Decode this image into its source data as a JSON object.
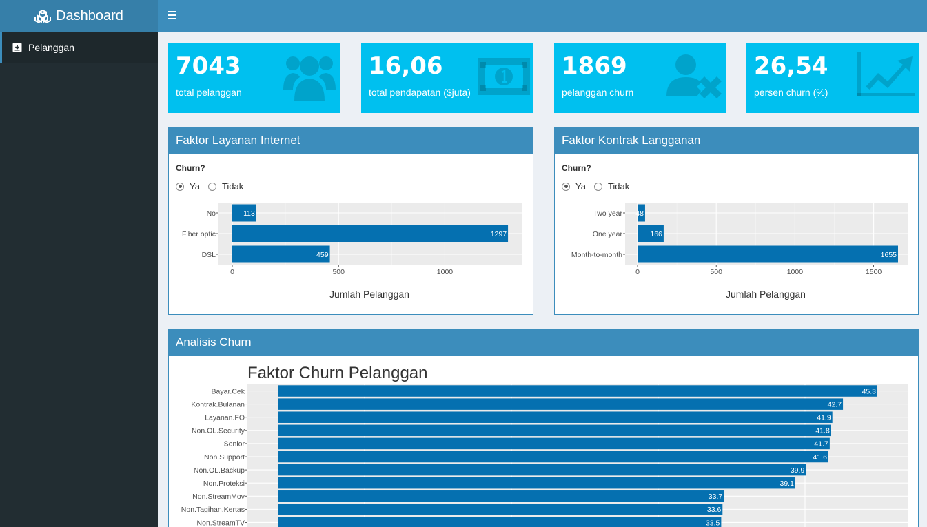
{
  "brand": {
    "title": "Dashboard"
  },
  "sidebar": {
    "items": [
      {
        "label": "Pelanggan"
      }
    ]
  },
  "value_boxes": [
    {
      "value": "7043",
      "label": "total pelanggan",
      "icon": "users-icon"
    },
    {
      "value": "16,06",
      "label": "total pendapatan ($juta)",
      "icon": "money-icon"
    },
    {
      "value": "1869",
      "label": "pelanggan churn",
      "icon": "user-times-icon"
    },
    {
      "value": "26,54",
      "label": "persen churn (%)",
      "icon": "line-chart-icon"
    }
  ],
  "colors": {
    "accent": "#3c8dbc",
    "value_box": "#00c0ef",
    "bar": "#0570b0",
    "sidebar": "#222d32"
  },
  "internet_box": {
    "title": "Faktor Layanan Internet",
    "radio_label": "Churn?",
    "options": [
      "Ya",
      "Tidak"
    ],
    "selected": "Ya"
  },
  "contract_box": {
    "title": "Faktor Kontrak Langganan",
    "radio_label": "Churn?",
    "options": [
      "Ya",
      "Tidak"
    ],
    "selected": "Ya"
  },
  "analysis_box": {
    "title": "Analisis Churn"
  },
  "chart_data": [
    {
      "type": "bar",
      "orientation": "horizontal",
      "categories": [
        "No",
        "Fiber optic",
        "DSL"
      ],
      "values": [
        113,
        1297,
        459
      ],
      "xlabel": "Jumlah Pelanggan",
      "ylabel": "",
      "xlim": [
        0,
        1300
      ],
      "xticks": [
        0,
        500,
        1000
      ],
      "grid": true
    },
    {
      "type": "bar",
      "orientation": "horizontal",
      "categories": [
        "Two year",
        "One year",
        "Month-to-month"
      ],
      "values": [
        48,
        166,
        1655
      ],
      "xlabel": "Jumlah Pelanggan",
      "ylabel": "",
      "xlim": [
        0,
        1655
      ],
      "xticks": [
        0,
        500,
        1000,
        1500
      ],
      "grid": true
    },
    {
      "type": "bar",
      "orientation": "horizontal",
      "title": "Faktor Churn Pelanggan",
      "categories": [
        "Bayar.Cek",
        "Kontrak.Bulanan",
        "Layanan.FO",
        "Non.OL.Security",
        "Senior",
        "Non.Support",
        "Non.OL.Backup",
        "Non.Proteksi",
        "Non.StreamMov",
        "Non.Tagihan.Kertas",
        "Non.StreamTV"
      ],
      "values": [
        45.3,
        42.7,
        41.9,
        41.8,
        41.7,
        41.6,
        39.9,
        39.1,
        33.7,
        33.6,
        33.5
      ],
      "xlim": [
        0,
        45.3
      ],
      "grid": true
    }
  ]
}
